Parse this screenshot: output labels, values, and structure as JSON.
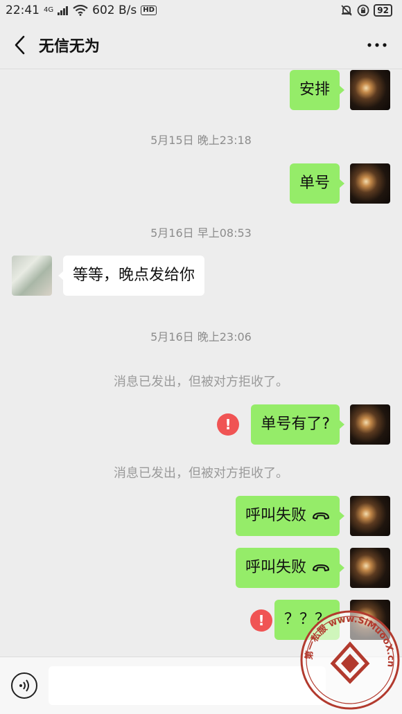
{
  "status_bar": {
    "time": "22:41",
    "network": "4G",
    "speed": "602 B/s",
    "hd": "HD",
    "battery": "92"
  },
  "header": {
    "title": "无信无为"
  },
  "messages": {
    "m1": "安排",
    "ts1": "5月15日 晚上23:18",
    "m2": "单号",
    "ts2": "5月16日 早上08:53",
    "m3": "等等，晚点发给你",
    "ts3": "5月16日 晚上23:06",
    "sys1": "消息已发出，但被对方拒收了。",
    "m4": "单号有了?",
    "sys2": "消息已发出，但被对方拒收了。",
    "m5": "呼叫失败",
    "m6": "呼叫失败",
    "m7": "？？？"
  },
  "error_mark": "!",
  "watermark": {
    "text": "第一私服 www.SiMuooX.cn"
  },
  "colors": {
    "self_bubble": "#95ec69",
    "other_bubble": "#ffffff",
    "error": "#f05454",
    "background": "#ededed"
  },
  "icons": {
    "back": "chevron-left-icon",
    "more": "more-dots-icon",
    "voice": "voice-icon",
    "call_failed": "phone-hangup-icon"
  }
}
